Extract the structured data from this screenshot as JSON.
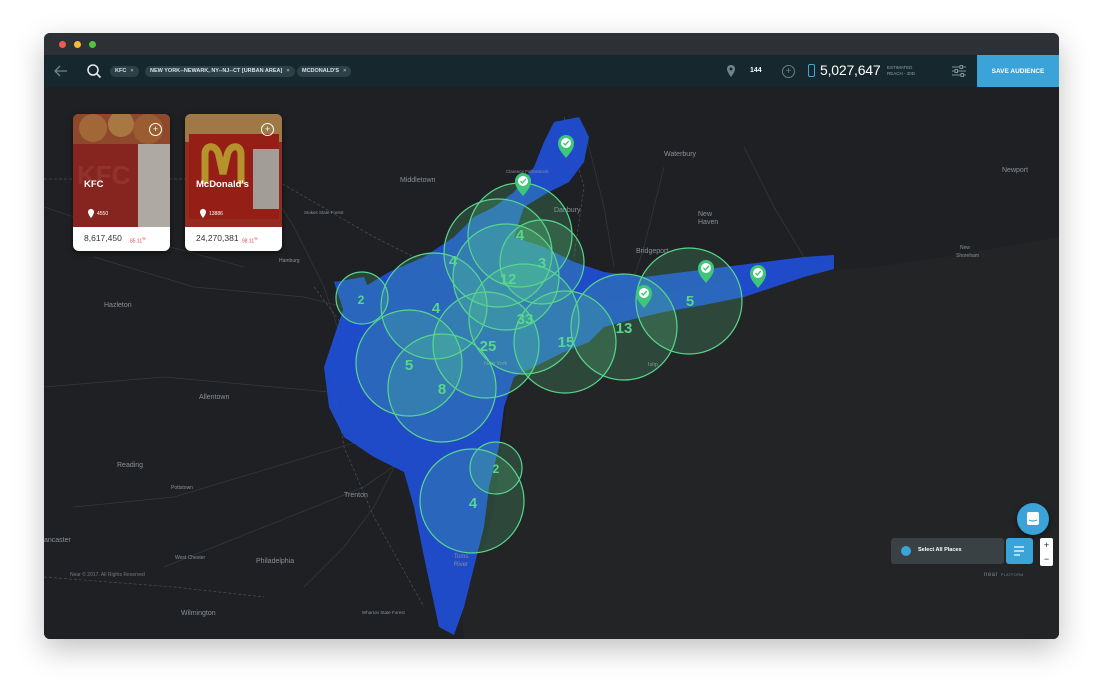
{
  "window": {
    "traffic_lights": [
      "close",
      "minimize",
      "maximize"
    ]
  },
  "toolbar": {
    "chips": [
      {
        "label": "KFC"
      },
      {
        "label": "NEW YORK--NEWARK, NY--NJ--CT [URBAN AREA]"
      },
      {
        "label": "MCDONALD'S"
      }
    ],
    "chip_close_glyph": "×",
    "places_count": "144",
    "reach_value": "5,027,647",
    "reach_label_1": "ESTIMATED",
    "reach_label_2": "REACH - 30D",
    "save_label": "SAVE AUDIENCE"
  },
  "cards": [
    {
      "title": "KFC",
      "place_count": "4550",
      "reach": "8,617,450",
      "pct": "85.11",
      "pct_sup": "%",
      "add_glyph": "+"
    },
    {
      "title": "McDonald's",
      "place_count": "13886",
      "reach": "24,270,381",
      "pct": "98.11",
      "pct_sup": "%",
      "add_glyph": "+"
    }
  ],
  "map": {
    "cities": [
      "Middletown",
      "Waterbury",
      "Newport",
      "Clarence Fahnestock",
      "Danbury",
      "Haven",
      "New Haven",
      "Bridgeport",
      "New Shoreham",
      "Hazleton",
      "Allentown",
      "New York",
      "Islip",
      "Reading",
      "Trenton",
      "Toms River",
      "Philadelphia",
      "Wilmington",
      "Lancaster",
      "Pottstown",
      "West Chester",
      "Wharton State Forest",
      "Hamburg",
      "Stokes State Forest"
    ],
    "clusters": [
      "4",
      "3",
      "12",
      "4",
      "2",
      "4",
      "33",
      "15",
      "13",
      "5",
      "25",
      "5",
      "8",
      "2",
      "4"
    ]
  },
  "footer": {
    "copyright": "Near © 2017. All Rights Reserved",
    "brand": "near",
    "brand_sub": "PLATFORM"
  },
  "controls": {
    "select_all_label": "Select All Places",
    "zoom_in": "+",
    "zoom_out": "−"
  },
  "colors": {
    "accent": "#3aa3d7",
    "cluster_green": "#58d68d",
    "coverage_blue": "#1f4fd8",
    "map_bg": "#1d1f22"
  }
}
